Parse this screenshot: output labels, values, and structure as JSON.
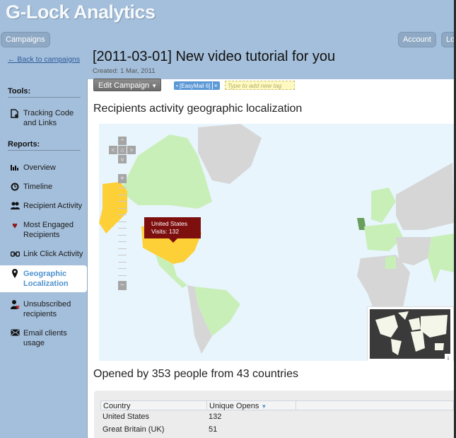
{
  "app": {
    "title": "G-Lock Analytics"
  },
  "topnav": {
    "campaigns": "Campaigns",
    "account": "Account",
    "logout": "Lo"
  },
  "back_link": "← Back to campaigns",
  "campaign": {
    "title": "[2011-03-01] New video tutorial for you",
    "created": "Created: 1 Mar, 2011"
  },
  "sidebar": {
    "tools_heading": "Tools:",
    "reports_heading": "Reports:",
    "tools": [
      {
        "label": "Tracking Code and Links",
        "icon": "download-document-icon"
      }
    ],
    "reports": [
      {
        "label": "Overview",
        "icon": "bar-chart-icon"
      },
      {
        "label": "Timeline",
        "icon": "clock-icon"
      },
      {
        "label": "Recipient Activity",
        "icon": "users-icon"
      },
      {
        "label": "Most Engaged Recipients",
        "icon": "heart-icon"
      },
      {
        "label": "Link Click Activity",
        "icon": "link-icon"
      },
      {
        "label": "Geographic Localization",
        "icon": "map-pin-icon",
        "active": true
      },
      {
        "label": "Unsubscribed recipients",
        "icon": "user-remove-icon"
      },
      {
        "label": "Email clients usage",
        "icon": "envelope-icon"
      }
    ]
  },
  "toolbar": {
    "edit_campaign": "Edit Campaign",
    "tag": "[EasyMail 6]",
    "tag_remove": "×",
    "new_tag_placeholder": "Type to add new tag"
  },
  "map_section": {
    "heading": "Recipients activity geographic localization",
    "tooltip": {
      "country": "United States",
      "visits": "Visits: 132"
    },
    "colors": {
      "ocean": "#e8f5fd",
      "no_data": "#d6d6d6",
      "low": "#c9efb9",
      "medium": "#6a9e5c",
      "highlight": "#fdd037",
      "tooltip": "#7d0f0f"
    },
    "nav": {
      "up": "^",
      "down": "v",
      "left": "<",
      "right": ">",
      "home": "⌂",
      "zoom_in": "+",
      "zoom_out": "−"
    },
    "minimap_toggle": "↓"
  },
  "summary": {
    "heading": "Opened by 353 people from 43 countries"
  },
  "table": {
    "columns": [
      "Country",
      "Unique Opens"
    ],
    "sort_indicator": "▼",
    "rows": [
      {
        "country": "United States",
        "opens": "132"
      },
      {
        "country": "Great Britain (UK)",
        "opens": "51"
      }
    ]
  }
}
